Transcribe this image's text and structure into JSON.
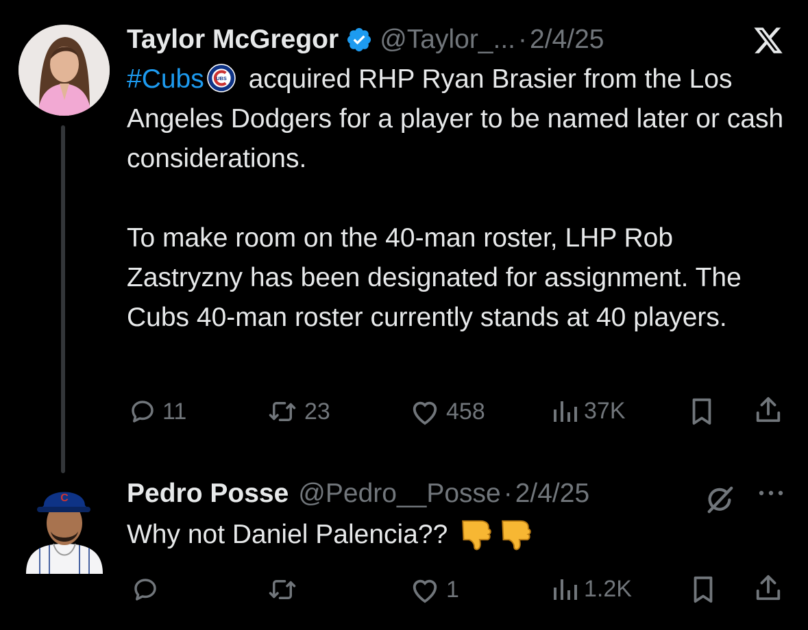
{
  "tweets": [
    {
      "author_name": "Taylor McGregor",
      "handle": "@Taylor_...",
      "separator": "·",
      "date": "2/4/25",
      "hashtag": "#Cubs",
      "text_line1_rest": " acquired RHP Ryan Brasier from the Los Angeles Dodgers for a player to be named later or cash considerations.",
      "text_para2": "To make room on the 40-man roster, LHP Rob Zastryzny has been designated for assignment. The Cubs 40-man roster currently stands at 40 players.",
      "actions": {
        "replies": "11",
        "reposts": "23",
        "likes": "458",
        "views": "37K"
      }
    },
    {
      "author_name": "Pedro Posse",
      "handle": "@Pedro__Posse",
      "separator": "·",
      "date": "2/4/25",
      "text": "Why not Daniel Palencia??",
      "actions": {
        "replies": "",
        "reposts": "",
        "likes": "1",
        "views": "1.2K"
      }
    }
  ],
  "icons": {
    "top_right": "x-logo-icon",
    "reply_menu": [
      "grok-icon",
      "more-icon"
    ],
    "emoji": "thumbs-down-icon"
  },
  "colors": {
    "background": "#000000",
    "text": "#e7e9ea",
    "secondary": "#71767b",
    "link": "#1d9bf0",
    "verified": "#1d9bf0"
  }
}
